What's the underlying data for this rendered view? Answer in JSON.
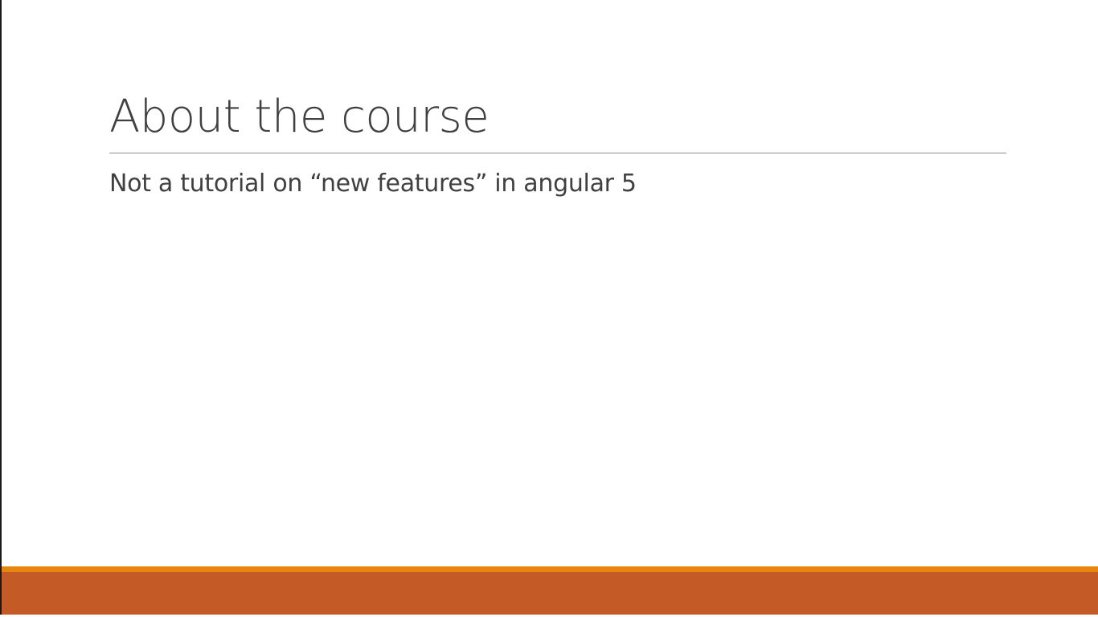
{
  "slide": {
    "title": "About the course",
    "body": "Not a tutorial on “new features” in angular 5"
  },
  "theme": {
    "text_color": "#404040",
    "rule_color": "#8c8c8c",
    "footer_accent_color": "#e8850f",
    "footer_band_color": "#c45b27"
  }
}
